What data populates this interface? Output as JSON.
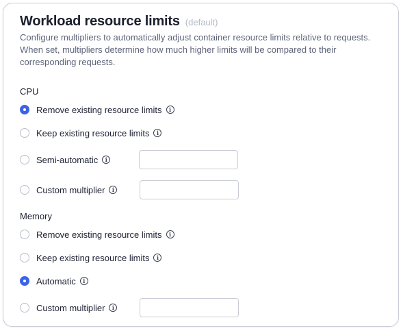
{
  "header": {
    "title": "Workload resource limits",
    "subtitle": "(default)",
    "description": "Configure multipliers to automatically adjust container resource limits relative to requests. When set, multipliers determine how much higher limits will be compared to their corresponding requests."
  },
  "cpu": {
    "label": "CPU",
    "options": [
      {
        "label": "Remove existing resource limits",
        "checked": true
      },
      {
        "label": "Keep existing resource limits",
        "checked": false
      },
      {
        "label": "Semi-automatic",
        "checked": false,
        "input_value": ""
      },
      {
        "label": "Custom multiplier",
        "checked": false,
        "input_value": ""
      }
    ]
  },
  "memory": {
    "label": "Memory",
    "options": [
      {
        "label": "Remove existing resource limits",
        "checked": false
      },
      {
        "label": "Keep existing resource limits",
        "checked": false
      },
      {
        "label": "Automatic",
        "checked": true
      },
      {
        "label": "Custom multiplier",
        "checked": false,
        "input_value": ""
      }
    ]
  },
  "icons": {
    "info": "info-icon",
    "radio": "radio-button"
  },
  "colors": {
    "accent": "#3a64e8",
    "title": "#1b1f2e",
    "muted": "#5e6478",
    "subtle": "#b3b7c4"
  }
}
